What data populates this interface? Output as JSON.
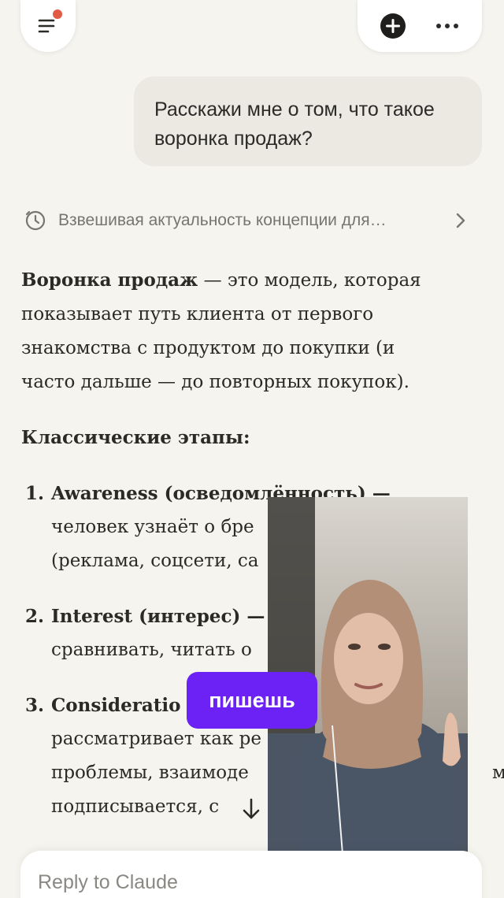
{
  "user_message": {
    "line1": "Расскажи мне о том, что такое",
    "line2": "воронка продаж?"
  },
  "thinking": {
    "summary": "Взвешивая актуальность концепции для…"
  },
  "response": {
    "intro_bold": "Воронка продаж",
    "intro_line1_rest": " — это модель, которая",
    "intro_line2": "показывает путь клиента от первого",
    "intro_line3": "знакомства с продуктом до покупки (и",
    "intro_line4": "часто дальше — до повторных покупок).",
    "stages_heading": "Классические этапы:",
    "stages": [
      {
        "number": "1.",
        "title": "Awareness (осведомлённость) —",
        "line2": "человек узнаёт о бре",
        "line3": "(реклама, соцсети, са"
      },
      {
        "number": "2.",
        "title": "Interest (интерес) —",
        "line2": "сравнивать, читать о"
      },
      {
        "number": "3.",
        "title": "Consideratio",
        "line2": "рассматривает как ре",
        "line3": "проблемы, взаимоде",
        "line3_right": "м,",
        "line4": "подписывается, с"
      }
    ]
  },
  "overlay": {
    "caption": "пишешь"
  },
  "composer": {
    "placeholder": "Reply to Claude"
  },
  "colors": {
    "background": "#f5f4ef",
    "user_bubble": "#ebe9e2",
    "notification_dot": "#e25b45",
    "caption_chip": "#6c22f5"
  },
  "icons": {
    "menu": "menu-lines-icon",
    "new_chat": "plus-circle-icon",
    "more": "ellipsis-icon",
    "thinking": "clock-icon",
    "expand": "chevron-right-icon",
    "scroll": "arrow-down-icon"
  }
}
